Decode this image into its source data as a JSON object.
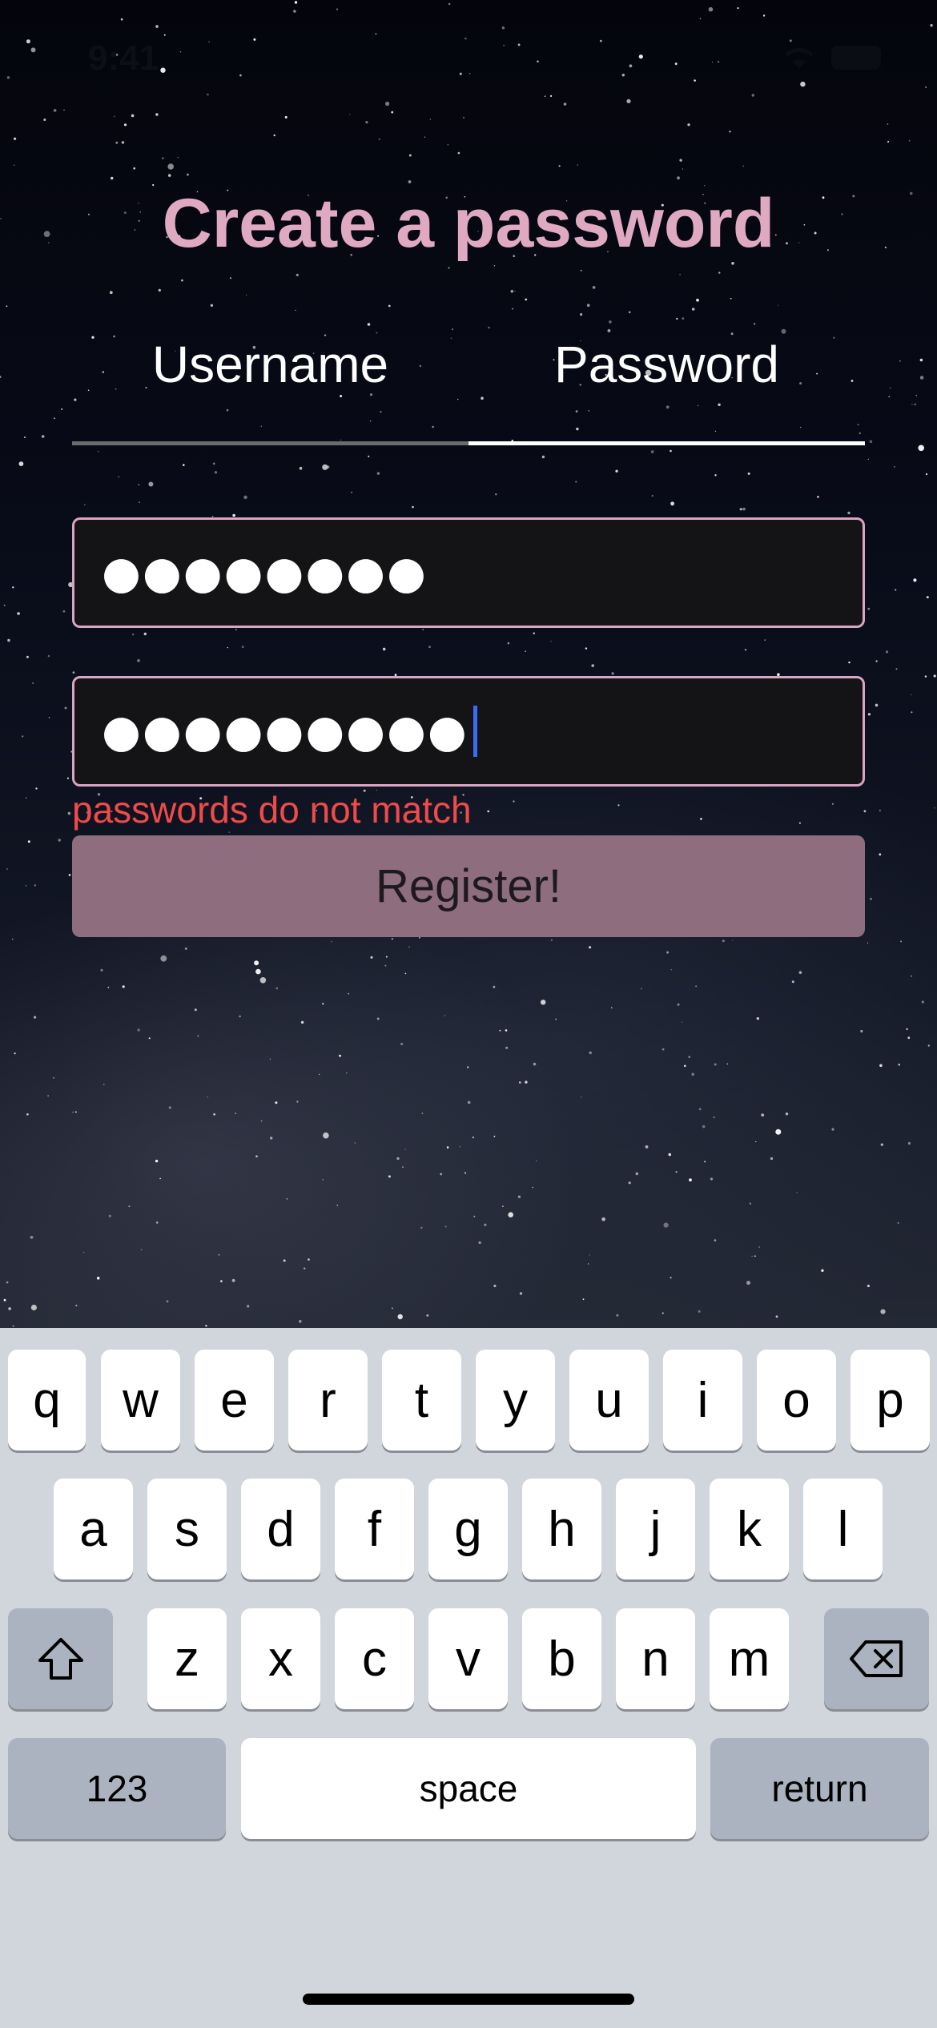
{
  "status_bar": {
    "time": "9:41"
  },
  "title": "Create a password",
  "tabs": [
    {
      "label": "Username",
      "active": false
    },
    {
      "label": "Password",
      "active": true
    }
  ],
  "fields": {
    "password": {
      "masked_value": "●●●●●●●●"
    },
    "confirm_password": {
      "masked_value": "●●●●●●●●●"
    }
  },
  "error_message": "passwords do not match",
  "register_button": "Register!",
  "keyboard": {
    "row1": [
      "q",
      "w",
      "e",
      "r",
      "t",
      "y",
      "u",
      "i",
      "o",
      "p"
    ],
    "row2": [
      "a",
      "s",
      "d",
      "f",
      "g",
      "h",
      "j",
      "k",
      "l"
    ],
    "row3": [
      "z",
      "x",
      "c",
      "v",
      "b",
      "n",
      "m"
    ],
    "numbers_key": "123",
    "space_key": "space",
    "return_key": "return",
    "shift_icon": "shift-arrow-icon",
    "delete_icon": "backspace-icon"
  },
  "colors": {
    "title": "#e0a9c2",
    "field_border": "#d9a5c1",
    "error": "#f04a4a",
    "button": "#8e6d7e",
    "caret": "#3b6cf4"
  }
}
